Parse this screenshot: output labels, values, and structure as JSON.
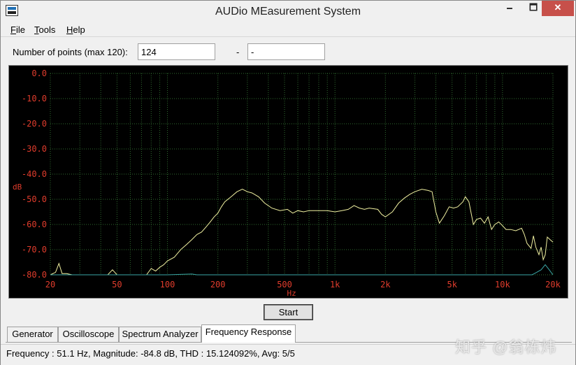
{
  "window": {
    "title": "AUDio MEasurement System",
    "minimize_glyph": "🗕",
    "maximize_glyph": "🗖",
    "close_glyph": "✕"
  },
  "menu": [
    {
      "label": "File",
      "mnemonic": "F",
      "rest": "ile"
    },
    {
      "label": "Tools",
      "mnemonic": "T",
      "rest": "ools"
    },
    {
      "label": "Help",
      "mnemonic": "H",
      "rest": "elp"
    }
  ],
  "params": {
    "points_label": "Number of points (max 120):",
    "points_value": "124",
    "separator": "-",
    "end_value": "-"
  },
  "start_button": "Start",
  "tabs": [
    {
      "label": "Generator",
      "active": false
    },
    {
      "label": "Oscilloscope",
      "active": false
    },
    {
      "label": "Spectrum Analyzer",
      "active": false
    },
    {
      "label": "Frequency Response",
      "active": true
    }
  ],
  "status": "Frequency : 51.1 Hz, Magnitude: -84.8 dB, THD : 15.124092%, Avg: 5/5",
  "watermark": "知乎 @翁栋炜",
  "chart_data": {
    "type": "line",
    "xlabel": "Hz",
    "ylabel": "dB",
    "x_scale": "log",
    "xlim": [
      20,
      20000
    ],
    "ylim": [
      -80,
      0
    ],
    "y_ticks": [
      "0.0",
      "-10.0",
      "-20.0",
      "-30.0",
      "-40.0",
      "-50.0",
      "-60.0",
      "-70.0",
      "-80.0"
    ],
    "x_ticks": [
      {
        "v": 20,
        "label": "20"
      },
      {
        "v": 50,
        "label": "50"
      },
      {
        "v": 100,
        "label": "100"
      },
      {
        "v": 200,
        "label": "200"
      },
      {
        "v": 500,
        "label": "500"
      },
      {
        "v": 1000,
        "label": "1k"
      },
      {
        "v": 2000,
        "label": "2k"
      },
      {
        "v": 5000,
        "label": "5k"
      },
      {
        "v": 10000,
        "label": "10k"
      },
      {
        "v": 20000,
        "label": "20k"
      }
    ],
    "grid": true,
    "colors": {
      "background": "#000000",
      "grid": "#2f6b2f",
      "axis_text": "#e03c2c",
      "series_main": "#f0f0a0",
      "series_thd": "#3aa6a6"
    },
    "series": [
      {
        "role": "main",
        "points": [
          [
            20,
            -80
          ],
          [
            21.5,
            -79
          ],
          [
            22.5,
            -75.5
          ],
          [
            23.5,
            -79.5
          ],
          [
            25,
            -79.5
          ],
          [
            27,
            -80
          ],
          [
            40,
            -80
          ],
          [
            44,
            -80
          ],
          [
            47,
            -78
          ],
          [
            50,
            -80
          ],
          [
            60,
            -80
          ],
          [
            75,
            -80
          ],
          [
            80,
            -77.5
          ],
          [
            85,
            -78.5
          ],
          [
            90,
            -77
          ],
          [
            95,
            -76
          ],
          [
            100,
            -74.5
          ],
          [
            110,
            -73
          ],
          [
            120,
            -70
          ],
          [
            130,
            -68
          ],
          [
            140,
            -66
          ],
          [
            150,
            -64
          ],
          [
            160,
            -63
          ],
          [
            170,
            -61
          ],
          [
            180,
            -59
          ],
          [
            190,
            -57
          ],
          [
            200,
            -55.5
          ],
          [
            210,
            -53
          ],
          [
            220,
            -51
          ],
          [
            240,
            -49
          ],
          [
            260,
            -47
          ],
          [
            280,
            -46
          ],
          [
            300,
            -47
          ],
          [
            320,
            -47.5
          ],
          [
            350,
            -49
          ],
          [
            380,
            -51.5
          ],
          [
            420,
            -53.5
          ],
          [
            470,
            -54.5
          ],
          [
            520,
            -54
          ],
          [
            560,
            -55.5
          ],
          [
            600,
            -54.5
          ],
          [
            650,
            -55
          ],
          [
            700,
            -54.5
          ],
          [
            800,
            -54.5
          ],
          [
            900,
            -54.5
          ],
          [
            1000,
            -55
          ],
          [
            1100,
            -54.5
          ],
          [
            1200,
            -54
          ],
          [
            1300,
            -52.5
          ],
          [
            1400,
            -53.5
          ],
          [
            1500,
            -54
          ],
          [
            1600,
            -53.5
          ],
          [
            1800,
            -54
          ],
          [
            1900,
            -56
          ],
          [
            2000,
            -57
          ],
          [
            2200,
            -55
          ],
          [
            2400,
            -51.5
          ],
          [
            2600,
            -49.5
          ],
          [
            2800,
            -48
          ],
          [
            3000,
            -47
          ],
          [
            3300,
            -46
          ],
          [
            3600,
            -46.5
          ],
          [
            3800,
            -47
          ],
          [
            4000,
            -55
          ],
          [
            4200,
            -59.5
          ],
          [
            4500,
            -56.5
          ],
          [
            4800,
            -53
          ],
          [
            5100,
            -53.5
          ],
          [
            5400,
            -53
          ],
          [
            5800,
            -51
          ],
          [
            6000,
            -49
          ],
          [
            6300,
            -51
          ],
          [
            6700,
            -60
          ],
          [
            7000,
            -58
          ],
          [
            7400,
            -57.5
          ],
          [
            7800,
            -59.5
          ],
          [
            8200,
            -57
          ],
          [
            8600,
            -62
          ],
          [
            9000,
            -60
          ],
          [
            9500,
            -59
          ],
          [
            10000,
            -60.5
          ],
          [
            10500,
            -62
          ],
          [
            11200,
            -62
          ],
          [
            12000,
            -62.5
          ],
          [
            13000,
            -61.5
          ],
          [
            13500,
            -64
          ],
          [
            14000,
            -67.5
          ],
          [
            14800,
            -69.5
          ],
          [
            15300,
            -64.5
          ],
          [
            15800,
            -69
          ],
          [
            16500,
            -72
          ],
          [
            17000,
            -69
          ],
          [
            17500,
            -74
          ],
          [
            18000,
            -72
          ],
          [
            18500,
            -65
          ],
          [
            19200,
            -66
          ],
          [
            20000,
            -67
          ]
        ]
      },
      {
        "role": "thd",
        "points": [
          [
            20,
            -80
          ],
          [
            100,
            -80
          ],
          [
            140,
            -79.7
          ],
          [
            150,
            -80
          ],
          [
            3000,
            -80
          ],
          [
            10000,
            -80
          ],
          [
            15000,
            -80
          ],
          [
            16000,
            -79
          ],
          [
            17000,
            -78
          ],
          [
            18000,
            -76
          ],
          [
            19000,
            -78
          ],
          [
            20000,
            -80
          ]
        ]
      }
    ]
  }
}
